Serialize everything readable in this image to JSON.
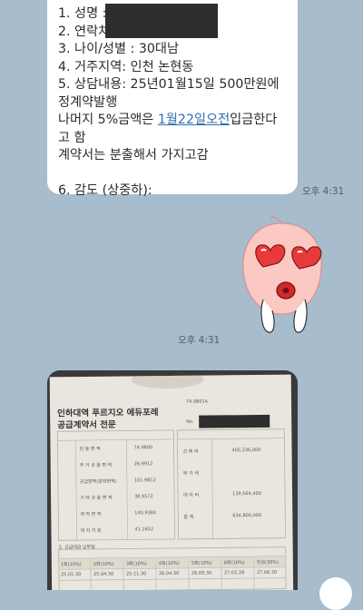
{
  "message": {
    "lines": [
      "1. 성명 : ",
      "2. 연락처 ",
      "3. 나이/성별 : 30대남",
      "4. 거주지역: 인천 논현동",
      "5. 상담내용: 25년01월15일 500만원에 정계약발행",
      "나머지 5%금액은 ",
      "1월22일오전",
      "입금한다고 함",
      "계약서는 분출해서 가지고감",
      "6. 감도 (상중하):"
    ],
    "time": "오후 4:31"
  },
  "sticker": {
    "icon": "peach-heart-eyes-sticker",
    "time": "오후 4:31"
  },
  "photo": {
    "title_line1": "인하대역 푸르지오 에듀포레",
    "title_line2": "공급계약서 전문",
    "stamp_code": "74.9801A",
    "stamp_prefix": "No.",
    "left_labels": [
      "전 용 면 적",
      "주 거 공 용 면 적",
      "공급면적(분양면적)",
      "기 타 공 용 면 적",
      "계 약 면 적",
      "대 지 지 분"
    ],
    "left_values": [
      "74.9800",
      "26.9912",
      "101.9812",
      "38.9572",
      "140.9384",
      "41.1652"
    ],
    "right_labels": [
      "건 축 비",
      "부 가 세",
      "대 지 비",
      "합 계"
    ],
    "right_values": [
      "405,236,000",
      "",
      "139,564,400",
      "634,800,000"
    ],
    "section_label": "2. 공급대금 납부일",
    "pay_headers": [
      "1회(10%)",
      "2회(10%)",
      "3회(10%)",
      "4회(10%)",
      "5회(10%)",
      "6회(10%)",
      "잔금(30%)"
    ],
    "pay_dates": [
      "25.01.30",
      "25.04.30",
      "25.11.30",
      "26.04.30",
      "26.09.30",
      "27.02.28",
      "27.06.30"
    ]
  }
}
